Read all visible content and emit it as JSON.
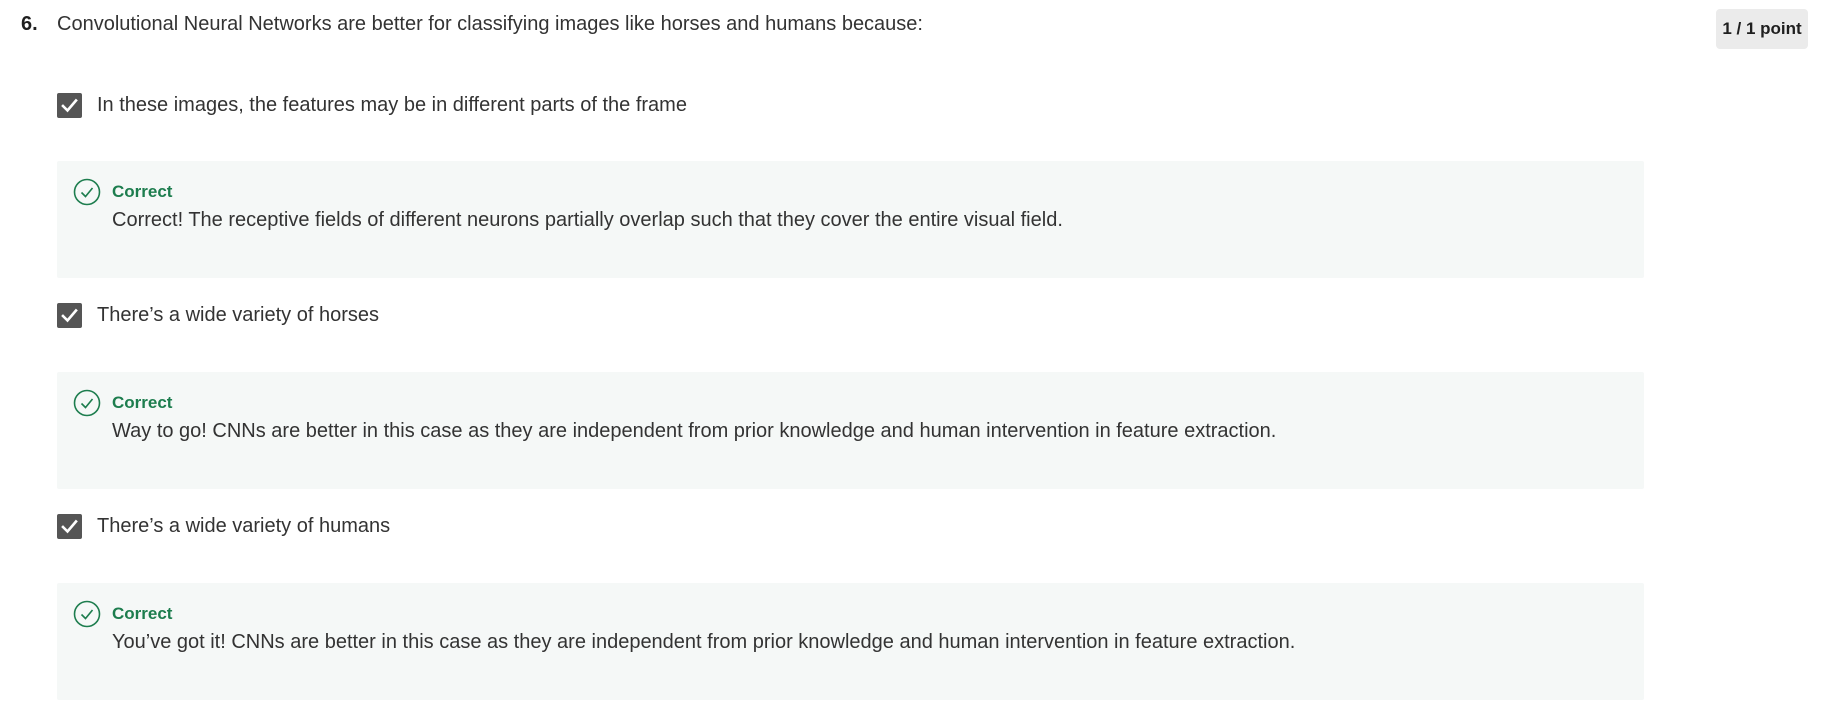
{
  "question": {
    "number": "6.",
    "text": "Convolutional Neural Networks are better for classifying images like horses and humans because:",
    "score": "1 / 1 point"
  },
  "options": [
    {
      "label": "In these images, the features may be in different parts of the frame",
      "checked": true,
      "feedback": {
        "status": "Correct",
        "message": "Correct! The receptive fields of different neurons partially overlap such that they cover the entire visual field."
      }
    },
    {
      "label": "There’s a wide variety of horses",
      "checked": true,
      "feedback": {
        "status": "Correct",
        "message": "Way to go! CNNs are better in this case as they are independent from prior knowledge and human intervention in feature extraction."
      }
    },
    {
      "label": "There’s a wide variety of humans",
      "checked": true,
      "feedback": {
        "status": "Correct",
        "message": "You’ve got it! CNNs are better in this case as they are independent from prior knowledge and human intervention in feature extraction."
      }
    }
  ],
  "colors": {
    "checkbox_fill": "#555555",
    "correct_green": "#1d7d4e",
    "feedback_background": "#f5f8f7",
    "score_badge_background": "#ebebeb"
  },
  "icons": {
    "checkbox": "checkmark-icon",
    "feedback": "check-circle-icon"
  }
}
